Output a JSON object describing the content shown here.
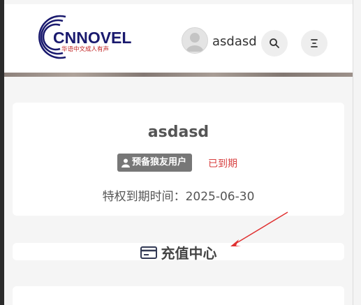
{
  "header": {
    "logo_text": "CNNOVEL",
    "logo_subtitle": "华语中文成人有声",
    "username": "asdasd",
    "icons": {
      "avatar": "user-avatar-icon",
      "search": "search-icon",
      "menu": "menu-icon"
    }
  },
  "profile": {
    "name": "asdasd",
    "role_label": "预备狼友用户",
    "status": "已到期",
    "vip_expire_label": "特权到期时间：",
    "vip_expire_date": "2025-06-30"
  },
  "recharge": {
    "title": "充值中心",
    "icon": "card-icon"
  },
  "colors": {
    "accent_navy": "#1a1a6e",
    "badge_gray": "#777777",
    "status_red": "#d84040",
    "annotation_red": "#e03030"
  }
}
